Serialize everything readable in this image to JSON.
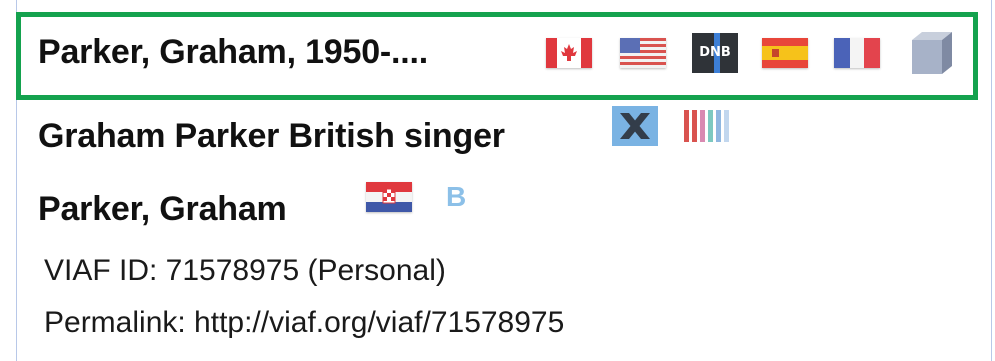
{
  "records": [
    {
      "name": "Parker, Graham, 1950-....",
      "icons": [
        "canada-flag-icon",
        "usa-flag-icon",
        "dnb-icon",
        "spain-flag-icon",
        "france-flag-icon",
        "cube-icon"
      ],
      "dnb_text": "DNB"
    },
    {
      "name": "Graham Parker British singer",
      "icons": [
        "wikidata-x-icon",
        "barcode-icon"
      ]
    },
    {
      "name": "Parker, Graham",
      "icons": [
        "croatia-flag-icon",
        "b-icon"
      ],
      "b_text": "B"
    }
  ],
  "viaf": {
    "id_line": "VIAF ID: 71578975 (Personal)",
    "permalink_line": "Permalink: http://viaf.org/viaf/71578975"
  },
  "colors": {
    "highlight_border": "#14a24e",
    "panel_border": "#b8c8e8"
  }
}
